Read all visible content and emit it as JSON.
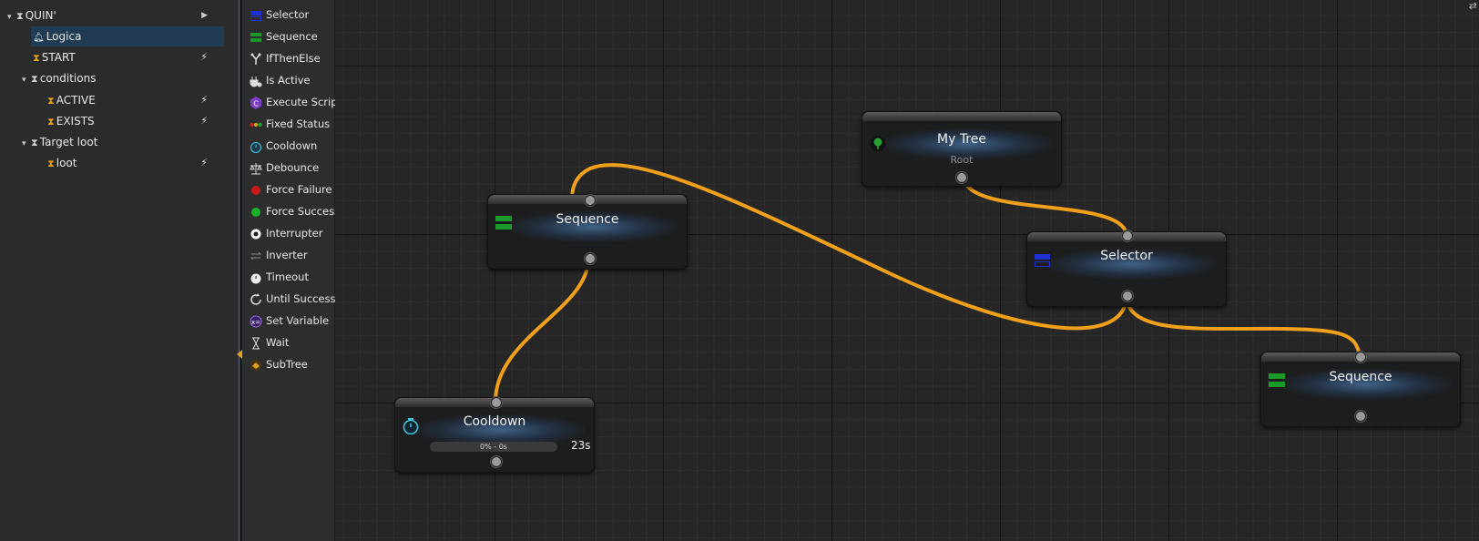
{
  "tree": {
    "items": [
      {
        "label": "QUIN'",
        "arrow": "▾",
        "icon": "hourglass-white",
        "trailing": "▸"
      },
      {
        "label": "Logica",
        "icon": "bell",
        "selected": true
      },
      {
        "label": "START",
        "icon": "hourglass",
        "trailing": "⚡"
      },
      {
        "label": "conditions",
        "arrow": "▾",
        "icon": "hourglass-white"
      },
      {
        "label": "ACTIVE",
        "icon": "hourglass",
        "trailing": "⚡"
      },
      {
        "label": "EXISTS",
        "icon": "hourglass",
        "trailing": "⚡"
      },
      {
        "label": "Target loot",
        "arrow": "▾",
        "icon": "hourglass-white"
      },
      {
        "label": "loot",
        "icon": "hourglass",
        "trailing": "⚡"
      }
    ]
  },
  "palette": {
    "items": [
      {
        "label": "Selector",
        "icon": "selector-icon"
      },
      {
        "label": "Sequence",
        "icon": "sequence-icon"
      },
      {
        "label": "IfThenElse",
        "icon": "branch-icon"
      },
      {
        "label": "Is Active",
        "icon": "plug-icon"
      },
      {
        "label": "Execute Script",
        "icon": "csharp-icon"
      },
      {
        "label": "Fixed Status",
        "icon": "traffic-light-icon"
      },
      {
        "label": "Cooldown",
        "icon": "stopwatch-icon"
      },
      {
        "label": "Debounce",
        "icon": "scale-icon"
      },
      {
        "label": "Force Failure",
        "icon": "red-dot-icon"
      },
      {
        "label": "Force Success",
        "icon": "green-dot-icon"
      },
      {
        "label": "Interrupter",
        "icon": "target-icon"
      },
      {
        "label": "Inverter",
        "icon": "swap-icon"
      },
      {
        "label": "Timeout",
        "icon": "timer-icon"
      },
      {
        "label": "Until Success",
        "icon": "loop-icon"
      },
      {
        "label": "Set Variable",
        "icon": "variable-icon"
      },
      {
        "label": "Wait",
        "icon": "hourglass-icon"
      },
      {
        "label": "SubTree",
        "icon": "subtree-icon"
      }
    ]
  },
  "nodes": {
    "root": {
      "title": "My Tree",
      "subtitle": "Root",
      "icon": "tree-icon"
    },
    "selector": {
      "title": "Selector",
      "icon": "selector-icon"
    },
    "sequence_a": {
      "title": "Sequence",
      "icon": "sequence-icon"
    },
    "sequence_b": {
      "title": "Sequence",
      "icon": "sequence-icon"
    },
    "cooldown": {
      "title": "Cooldown",
      "icon": "stopwatch-icon",
      "progress_text": "0% - 0s",
      "progress": 0,
      "seconds": "23s"
    }
  },
  "colors": {
    "wire": "#f0a01a",
    "selection": "#213b52",
    "accent_hourglass": "#e0a020"
  },
  "corner_glyph": "⇄"
}
